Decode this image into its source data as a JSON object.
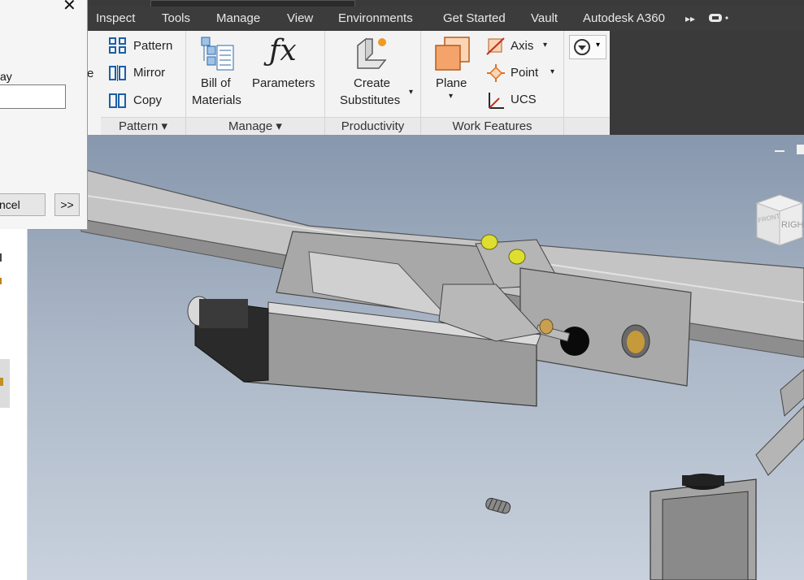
{
  "menu": {
    "tabs": [
      "Inspect",
      "Tools",
      "Manage",
      "View",
      "Environments",
      "Get Started",
      "Vault",
      "Autodesk A360"
    ]
  },
  "ribbon": {
    "pattern_panel": {
      "title": "Pattern",
      "items": [
        "Pattern",
        "Mirror",
        "Copy"
      ]
    },
    "manage_panel": {
      "title": "Manage",
      "bom_label_1": "Bill of",
      "bom_label_2": "Materials",
      "parameters_label": "Parameters"
    },
    "productivity_panel": {
      "title": "Productivity",
      "create_label_1": "Create",
      "create_label_2": "Substitutes"
    },
    "work_features_panel": {
      "title": "Work Features",
      "plane_label": "Plane",
      "axis_label": "Axis",
      "point_label": "Point",
      "ucs_label": "UCS"
    },
    "partial_e": "e"
  },
  "dialog": {
    "field_label_partial": "ay",
    "cancel_label_partial": "ncel",
    "more_label": ">>"
  },
  "viewcube": {
    "right_label": "RIGHT",
    "front_label": "FRONT"
  },
  "colors": {
    "tabbar": "#3c3c3c",
    "ribbon": "#f3f3f3",
    "viewport_top": "#8797ad",
    "viewport_bottom": "#c8d1dd"
  }
}
